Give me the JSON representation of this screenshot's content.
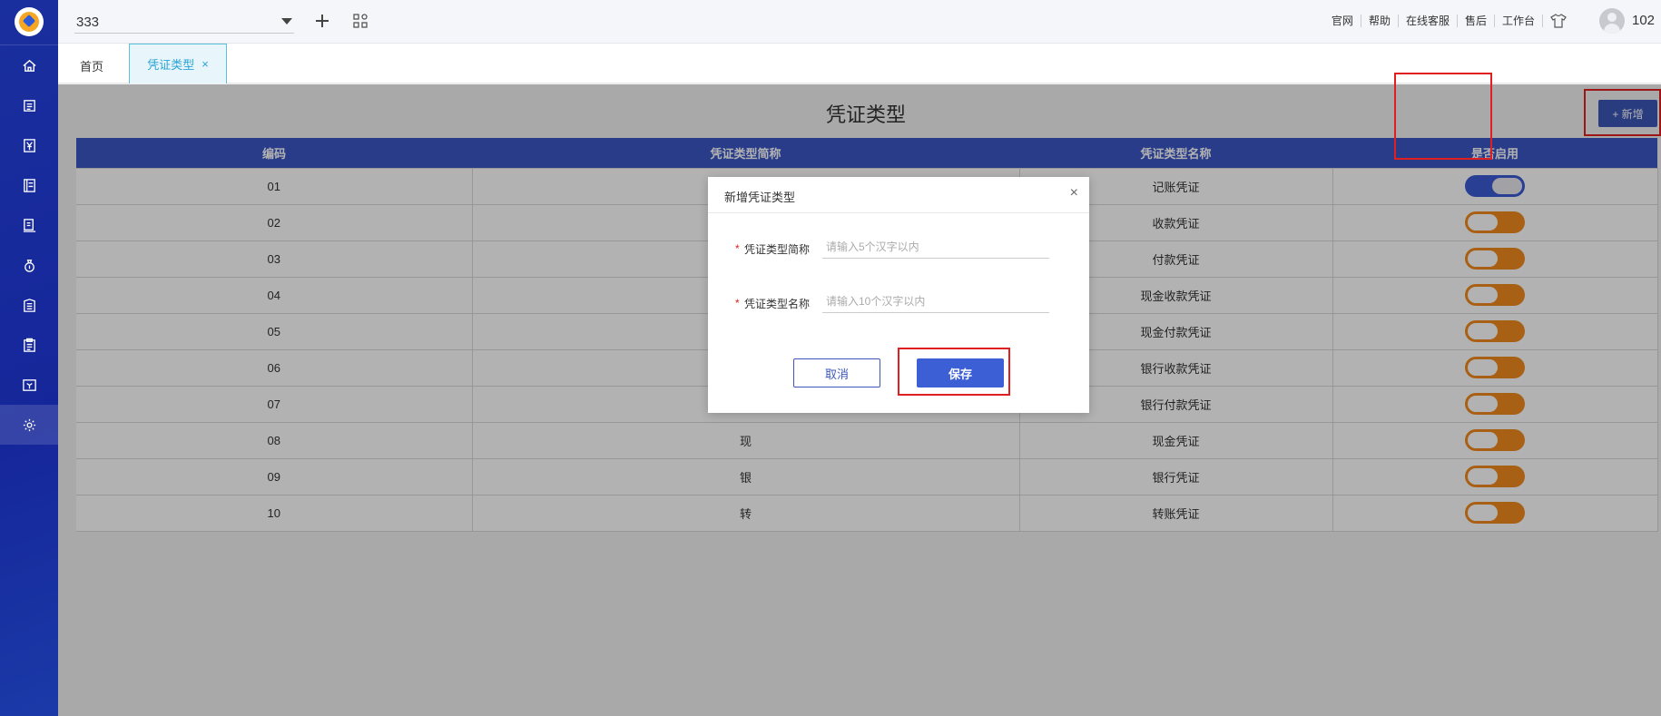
{
  "header": {
    "org_value": "333",
    "links": [
      "官网",
      "帮助",
      "在线客服",
      "售后",
      "工作台"
    ],
    "user_code": "102"
  },
  "tabs": {
    "home": "首页",
    "active": "凭证类型",
    "close": "×"
  },
  "page": {
    "title": "凭证类型",
    "add_label": "+ 新增"
  },
  "table": {
    "columns": [
      "编码",
      "凭证类型简称",
      "凭证类型名称",
      "是否启用"
    ],
    "rows": [
      {
        "code": "01",
        "abbr": "",
        "name": "记账凭证",
        "enabled": true
      },
      {
        "code": "02",
        "abbr": "",
        "name": "收款凭证",
        "enabled": false
      },
      {
        "code": "03",
        "abbr": "",
        "name": "付款凭证",
        "enabled": false
      },
      {
        "code": "04",
        "abbr": "",
        "name": "现金收款凭证",
        "enabled": false
      },
      {
        "code": "05",
        "abbr": "",
        "name": "现金付款凭证",
        "enabled": false
      },
      {
        "code": "06",
        "abbr": "",
        "name": "银行收款凭证",
        "enabled": false
      },
      {
        "code": "07",
        "abbr": "",
        "name": "银行付款凭证",
        "enabled": false
      },
      {
        "code": "08",
        "abbr": "现",
        "name": "现金凭证",
        "enabled": false
      },
      {
        "code": "09",
        "abbr": "银",
        "name": "银行凭证",
        "enabled": false
      },
      {
        "code": "10",
        "abbr": "转",
        "name": "转账凭证",
        "enabled": false
      }
    ]
  },
  "modal": {
    "title": "新增凭证类型",
    "close": "×",
    "field1_label": "凭证类型简称",
    "field1_placeholder": "请输入5个汉字以内",
    "field2_label": "凭证类型名称",
    "field2_placeholder": "请输入10个汉字以内",
    "required_mark": "*",
    "cancel_label": "取消",
    "save_label": "保存"
  },
  "colors": {
    "primary": "#3d57b8",
    "sidebar": "#1a2f9e",
    "toggle_off": "#ef8a1d",
    "toggle_on": "#3c5bd4",
    "highlight": "#e02020"
  },
  "icons": {
    "sidebar": [
      "home-icon",
      "document-icon",
      "yen-icon",
      "ledger-icon",
      "report-icon",
      "money-bag-icon",
      "building-icon",
      "clipboard-icon",
      "invoice-icon",
      "gear-icon"
    ]
  }
}
